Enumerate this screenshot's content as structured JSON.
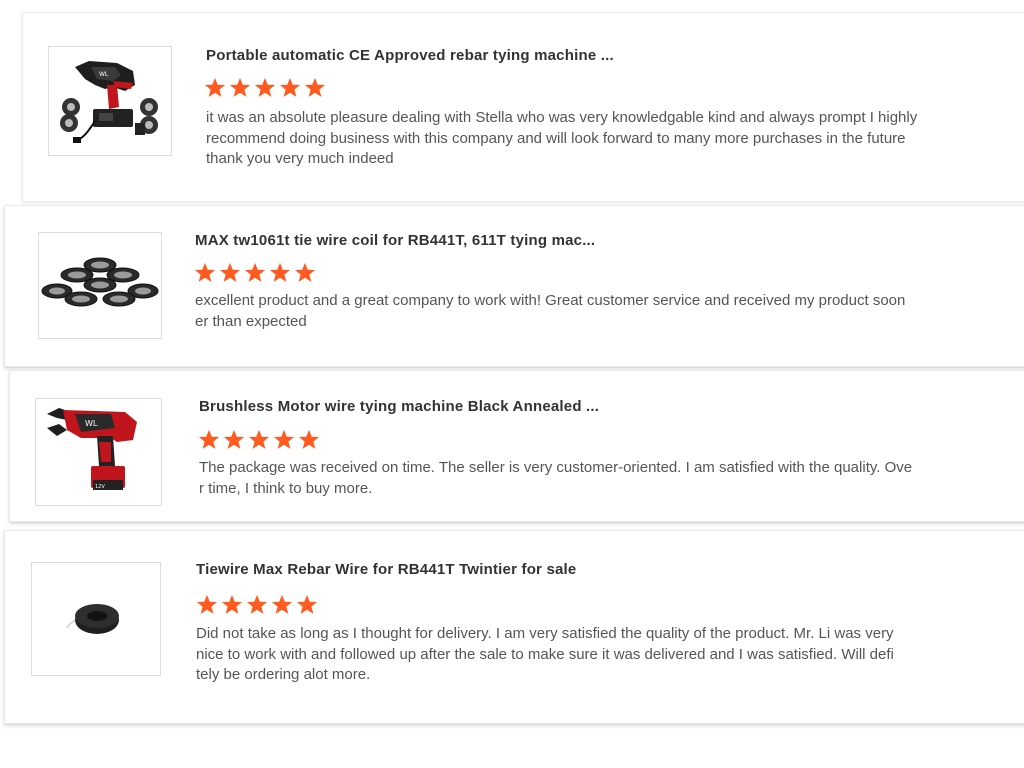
{
  "accent_star_color": "#ff5a1f",
  "reviews": [
    {
      "product_title": "Portable automatic CE Approved rebar tying machine ...",
      "rating": 5,
      "image_icon": "rebar-tying-machine-kit-image",
      "review_text": "it was an absolute pleasure dealing with Stella who was very knowledgable kind and always prompt I highly\nrecommend doing business with this company and will look forward to many more purchases in the future\nthank you very much indeed"
    },
    {
      "product_title": "MAX tw1061t tie wire coil for RB441T, 611T tying mac...",
      "rating": 5,
      "image_icon": "tie-wire-coils-image",
      "review_text": "excellent product and a great company to work with! Great customer service and received my product soon\ner than expected"
    },
    {
      "product_title": "Brushless Motor wire tying machine Black Annealed ...",
      "rating": 5,
      "image_icon": "wire-tying-machine-image",
      "review_text": "The package was received on time. The seller is very customer-oriented. I am satisfied with the quality. Ove\nr time, I think to buy more."
    },
    {
      "product_title": "Tiewire Max Rebar Wire for RB441T Twintier for sale",
      "rating": 5,
      "image_icon": "single-wire-coil-image",
      "review_text": "Did not take as long as I thought for delivery.  I am very satisfied the quality of the product. Mr. Li was very\nnice to work with and followed up after the sale to make sure it was delivered and I was satisfied. Will defi\ntely be ordering alot more."
    }
  ]
}
